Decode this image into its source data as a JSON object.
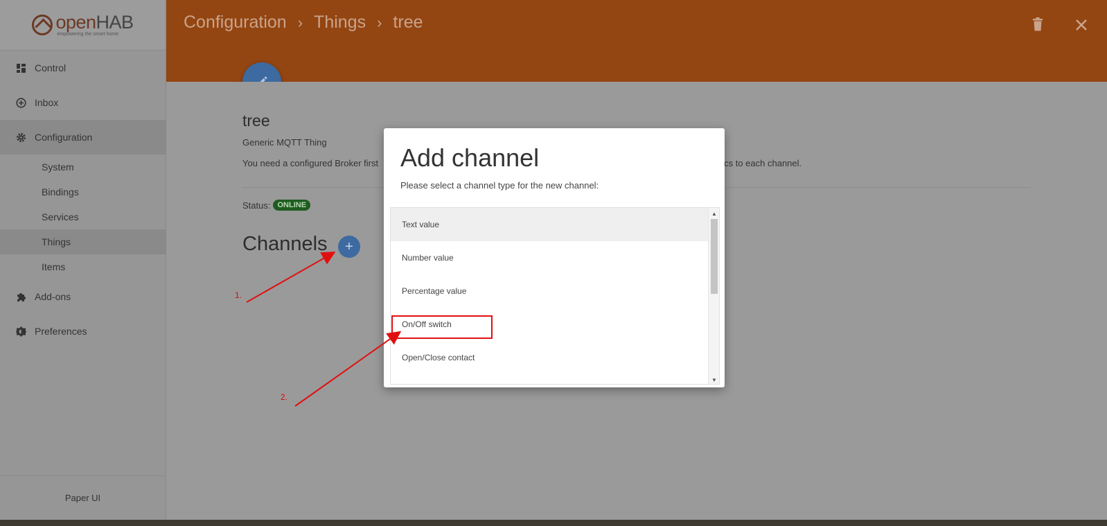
{
  "app": {
    "logo_text_main": "open",
    "logo_text_accent": "HAB",
    "logo_tagline": "empowering the smart home",
    "footer": "Paper UI"
  },
  "sidebar": {
    "items": [
      {
        "label": "Control",
        "icon": "dashboard-icon"
      },
      {
        "label": "Inbox",
        "icon": "add-circle-icon"
      },
      {
        "label": "Configuration",
        "icon": "gear-icon"
      },
      {
        "label": "Add-ons",
        "icon": "puzzle-icon"
      },
      {
        "label": "Preferences",
        "icon": "brightness-icon"
      }
    ],
    "sub_items": [
      "System",
      "Bindings",
      "Services",
      "Things",
      "Items"
    ]
  },
  "header": {
    "breadcrumbs": [
      "Configuration",
      "Things",
      "tree"
    ],
    "separator": "›",
    "delete_icon": "trash-icon",
    "close_icon": "close-icon"
  },
  "thing": {
    "name": "tree",
    "type": "Generic MQTT Thing",
    "desc_start": "You need a configured Broker first",
    "desc_end": "pics to each channel.",
    "status_label": "Status:",
    "status": "ONLINE",
    "channels_heading": "Channels",
    "add_symbol": "+"
  },
  "dialog": {
    "title": "Add channel",
    "subtitle": "Please select a channel type for the new channel:",
    "options": [
      "Text value",
      "Number value",
      "Percentage value",
      "On/Off switch",
      "Open/Close contact"
    ]
  },
  "annotations": {
    "step1": "1.",
    "step2": "2."
  },
  "colors": {
    "header": "#934512",
    "accent_blue": "#3d6aa0",
    "online_badge": "#1f5c1f",
    "annotation_red": "#e01010"
  }
}
